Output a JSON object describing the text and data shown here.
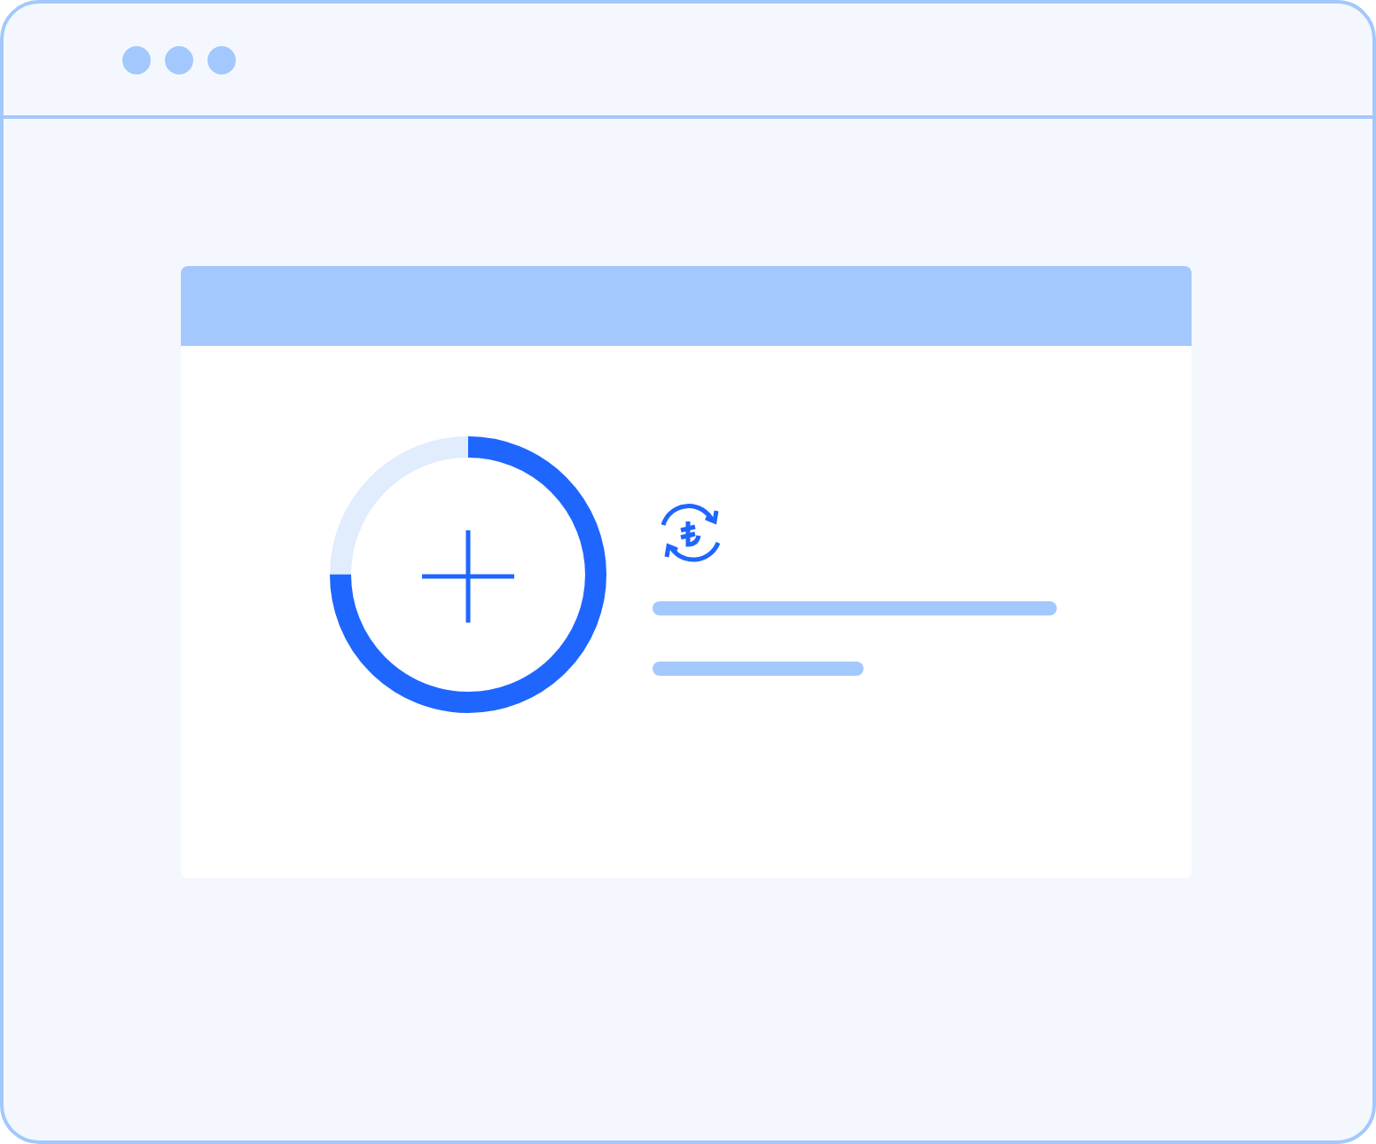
{
  "progress": {
    "level": 0.75
  }
}
